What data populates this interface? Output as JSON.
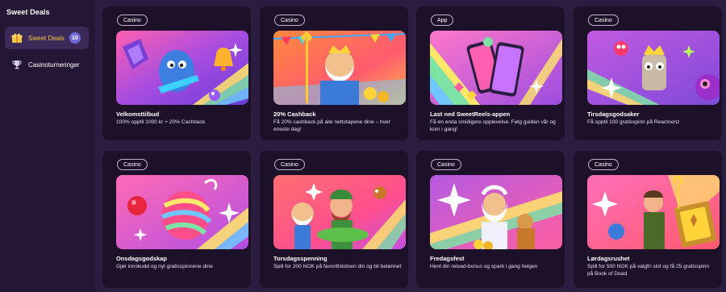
{
  "sidebar": {
    "title": "Sweet Deals",
    "items": [
      {
        "label": "Sweet Deals",
        "badge": "10",
        "icon": "gift-box-icon",
        "active": true
      },
      {
        "label": "Casinoturneringer",
        "icon": "trophy-icon",
        "active": false
      }
    ]
  },
  "promotions": [
    {
      "tag": "Casino",
      "title": "Velkomsttilbud",
      "description": "100% opptil 1000 kr + 20% Cashback",
      "art": "velkomst-art"
    },
    {
      "tag": "Casino",
      "title": "20% Cashback",
      "description": "Få 20% cashback på alle nettotapene dine – hver eneste dag!",
      "art": "poseidon-art"
    },
    {
      "tag": "App",
      "title": "Last ned SweetReels-appen",
      "description": "Få en enda smidigere opplevelse. Følg guiden vår og kom i gang!",
      "art": "phones-art"
    },
    {
      "tag": "Casino",
      "title": "Tirsdagsgodsaker",
      "description": "Få opptil 100 gratisspinn på Reactoonz",
      "art": "reactoonz-art"
    },
    {
      "tag": "Casino",
      "title": "Onsdagsgodskap",
      "description": "Gjør innskudd og nyt gratisspinnene dine",
      "art": "candy-art"
    },
    {
      "tag": "Casino",
      "title": "Torsdagsspenning",
      "description": "Spill for 200 NOK på favorittslotsen din og bli belønnet",
      "art": "fisherman-art"
    },
    {
      "tag": "Casino",
      "title": "Fredagsfest",
      "description": "Hent din reload-bonus og spark i gang helgen",
      "art": "zeus-art"
    },
    {
      "tag": "Casino",
      "title": "Lørdagsrushet",
      "description": "Spill for 500 NOK på valgfri slot og få 25 gratisspinn på Book of Dead",
      "art": "book-of-dead-art"
    }
  ],
  "colors": {
    "background": "#2a1d3f",
    "sidebar": "#231735",
    "card": "#1c1129",
    "active_label": "#f4c542",
    "badge": "#6f6ad8"
  }
}
